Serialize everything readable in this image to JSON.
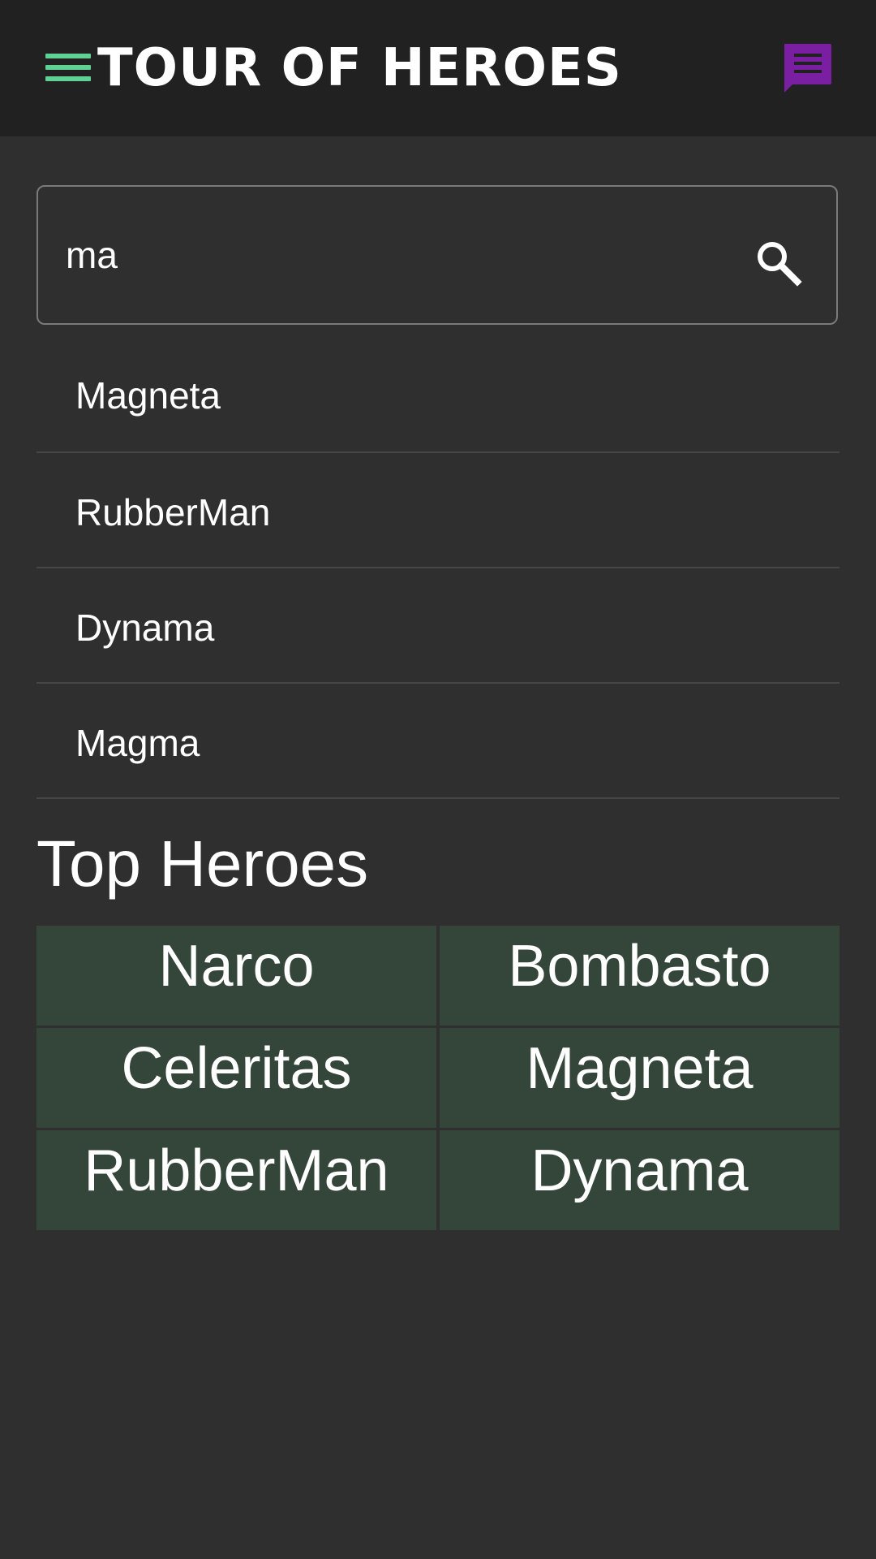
{
  "header": {
    "title": "TOUR OF HEROES",
    "menu_icon": "menu-icon",
    "messages_icon": "message-icon",
    "accent_color": "#5fd195",
    "messages_color": "#7b1fa2"
  },
  "search": {
    "value": "ma",
    "icon": "search-icon",
    "results": [
      "Magneta",
      "RubberMan",
      "Dynama",
      "Magma"
    ]
  },
  "dashboard": {
    "title": "Top Heroes",
    "tile_color": "#344539",
    "heroes": [
      "Narco",
      "Bombasto",
      "Celeritas",
      "Magneta",
      "RubberMan",
      "Dynama"
    ]
  }
}
